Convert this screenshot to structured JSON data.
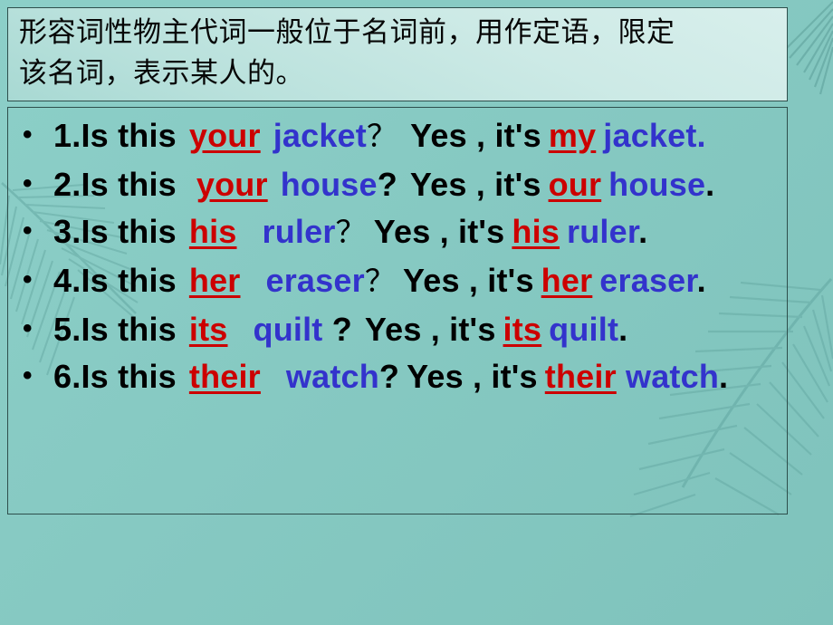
{
  "slide": {
    "background_color": "#86c9c2",
    "decorations": [
      "palm-frond-left",
      "palm-frond-right",
      "palm-frond-top-right"
    ]
  },
  "title": {
    "text": "形容词性物主代词一般位于名词前，用作定语，限定该名词，表示某人的。",
    "line1": "形容词性物主代词一般位于名词前，用作定语，限定",
    "line2": "该名词，表示某人的。",
    "font_color": "#060606",
    "box_border_color": "#2e4f4c",
    "box_fill_top": "#d8efec",
    "box_fill_bottom": "#a8d9d3"
  },
  "colors": {
    "possessive_red": "#CC0000",
    "noun_blue": "#3333CC",
    "text_black": "#000000"
  },
  "content": {
    "bullet_glyph": "•",
    "items": [
      {
        "number": "1.",
        "question_lead": "Is  this",
        "possessive_q": "your",
        "noun_q": "jacket",
        "question_mark": "？",
        "answer_lead": "Yes , it's",
        "possessive_a": "my",
        "noun_a": "jacket",
        "period": ".",
        "period_color": "blue"
      },
      {
        "number": "2.",
        "question_lead": "Is  this",
        "possessive_q": "your",
        "noun_q": "house",
        "question_mark": "?",
        "answer_lead": "Yes , it's",
        "possessive_a": "our",
        "noun_a": "house",
        "period": ".",
        "period_color": "black"
      },
      {
        "number": "3.",
        "question_lead": "Is  this",
        "possessive_q": "his",
        "noun_q": "ruler",
        "question_mark": "？",
        "answer_lead": "Yes , it's",
        "possessive_a": "his",
        "noun_a": "ruler",
        "period": ".",
        "period_color": "black"
      },
      {
        "number": "4.",
        "question_lead": "Is  this",
        "possessive_q": "her",
        "noun_q": "eraser",
        "question_mark": "？",
        "answer_lead": "Yes , it's",
        "possessive_a": "her",
        "noun_a": "eraser",
        "period": ".",
        "period_color": "black"
      },
      {
        "number": "5.",
        "question_lead": "Is  this",
        "possessive_q": "its",
        "noun_q": "quilt ",
        "question_mark": "?",
        "answer_lead": "Yes , it's",
        "possessive_a": "its",
        "noun_a": "quilt",
        "period": ".",
        "period_color": "black"
      },
      {
        "number": "6.",
        "question_lead": "Is  this",
        "possessive_q": "their",
        "noun_q": "watch",
        "question_mark": "?",
        "answer_lead": "Yes , it's",
        "possessive_a": "their",
        "noun_a": "watch",
        "period": ".",
        "period_color": "black"
      }
    ]
  }
}
